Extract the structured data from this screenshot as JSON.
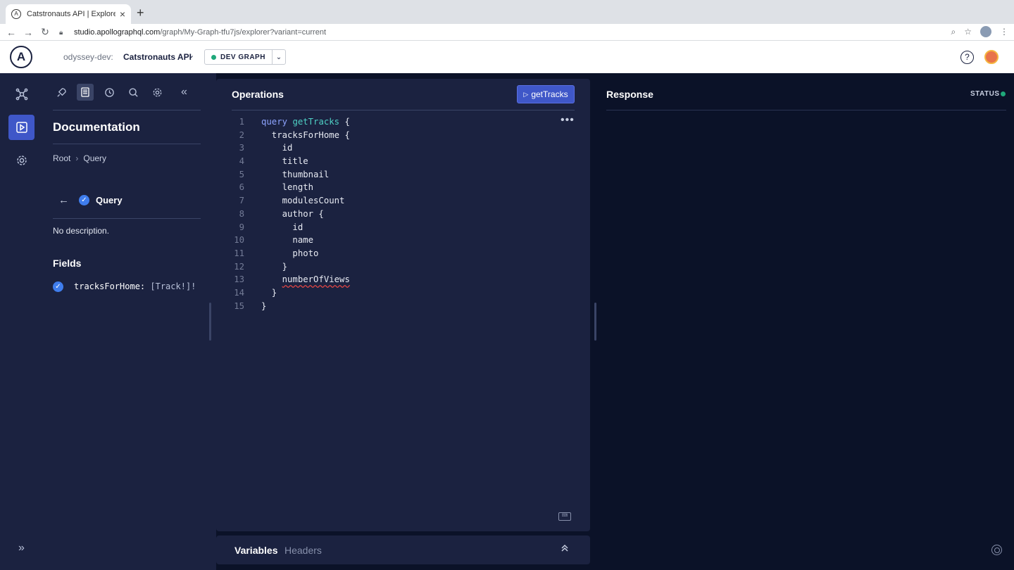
{
  "browser": {
    "tab_title": "Catstronauts API | Explorer | Studio",
    "tab_close": "×",
    "new_tab": "+",
    "url_host": "studio.apollographql.com",
    "url_path": "/graph/My-Graph-tfu7js/explorer?variant=current",
    "icons": [
      "back-arrow-icon",
      "forward-arrow-icon",
      "reload-icon",
      "lock-icon",
      "zoom-icon",
      "star-icon",
      "menu-dots-icon"
    ]
  },
  "header": {
    "logo": "A",
    "org": "odyssey-dev:",
    "graph_name": "Catstronauts API",
    "variant_badge": "DEV GRAPH",
    "help": "?"
  },
  "docs": {
    "title": "Documentation",
    "breadcrumb": {
      "root": "Root",
      "sep": "›",
      "current": "Query"
    },
    "back": "←",
    "type_name": "Query",
    "description": "No description.",
    "fields_heading": "Fields",
    "fields": [
      {
        "name": "tracksForHome:",
        "type": " [Track!]!"
      }
    ]
  },
  "operations": {
    "title": "Operations",
    "run_label": "getTracks",
    "lines": [
      {
        "no": "1",
        "pre": "",
        "kw": "query",
        "fn": "getTracks",
        "rest": " {"
      },
      {
        "no": "2",
        "text": "  tracksForHome {"
      },
      {
        "no": "3",
        "text": "    id"
      },
      {
        "no": "4",
        "text": "    title"
      },
      {
        "no": "5",
        "text": "    thumbnail"
      },
      {
        "no": "6",
        "text": "    length"
      },
      {
        "no": "7",
        "text": "    modulesCount"
      },
      {
        "no": "8",
        "text": "    author {"
      },
      {
        "no": "9",
        "text": "      id"
      },
      {
        "no": "10",
        "text": "      name"
      },
      {
        "no": "11",
        "text": "      photo"
      },
      {
        "no": "12",
        "text": "    }"
      },
      {
        "no": "13",
        "indent": "    ",
        "err": "numberOfViews"
      },
      {
        "no": "14",
        "text": "  }"
      },
      {
        "no": "15",
        "text": "}"
      }
    ]
  },
  "bottom": {
    "variables_tab": "Variables",
    "headers_tab": "Headers"
  },
  "response": {
    "title": "Response",
    "status_label": "STATUS"
  },
  "colors": {
    "accent": "#3f57c8",
    "status_ok": "#1fa87a",
    "panel": "#1b2240",
    "background": "#0b1228"
  }
}
